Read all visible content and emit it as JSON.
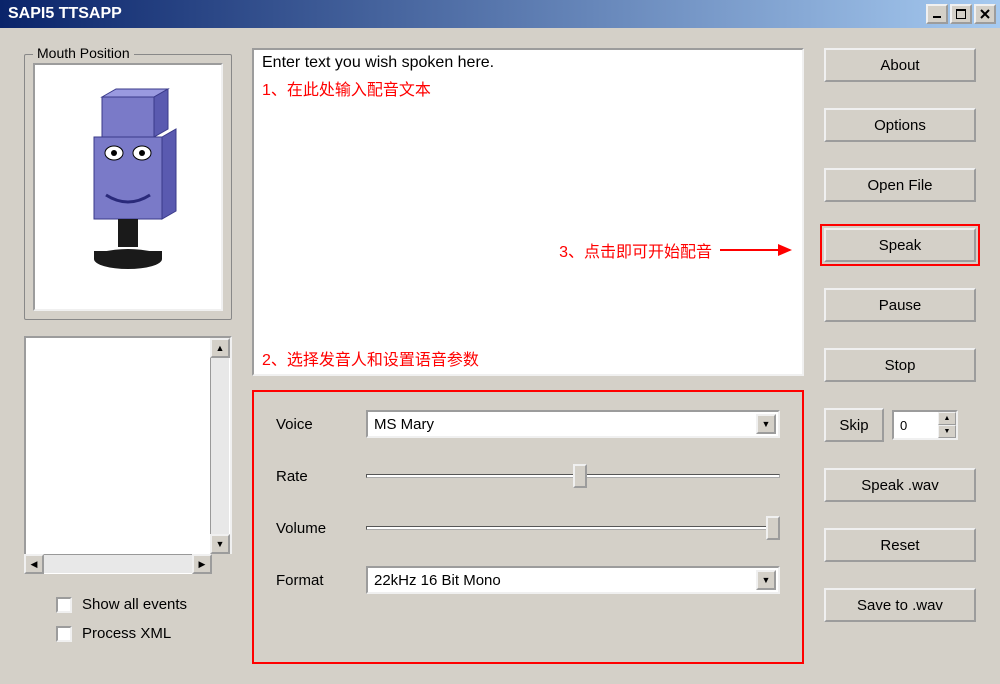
{
  "window": {
    "title": "SAPI5 TTSAPP"
  },
  "mouthPosition": {
    "label": "Mouth Position"
  },
  "checkboxes": {
    "showAllEvents": "Show all events",
    "processXML": "Process XML"
  },
  "textInput": {
    "placeholder": "Enter text you wish spoken here."
  },
  "annotations": {
    "a1": "1、在此处输入配音文本",
    "a2": "2、选择发音人和设置语音参数",
    "a3": "3、点击即可开始配音"
  },
  "params": {
    "voiceLabel": "Voice",
    "voiceValue": "MS Mary",
    "rateLabel": "Rate",
    "rateValue": 50,
    "volumeLabel": "Volume",
    "volumeValue": 100,
    "formatLabel": "Format",
    "formatValue": "22kHz 16 Bit Mono"
  },
  "buttons": {
    "about": "About",
    "options": "Options",
    "openFile": "Open File",
    "speak": "Speak",
    "pause": "Pause",
    "stop": "Stop",
    "skip": "Skip",
    "skipValue": "0",
    "speakWav": "Speak .wav",
    "reset": "Reset",
    "saveWav": "Save to .wav"
  }
}
